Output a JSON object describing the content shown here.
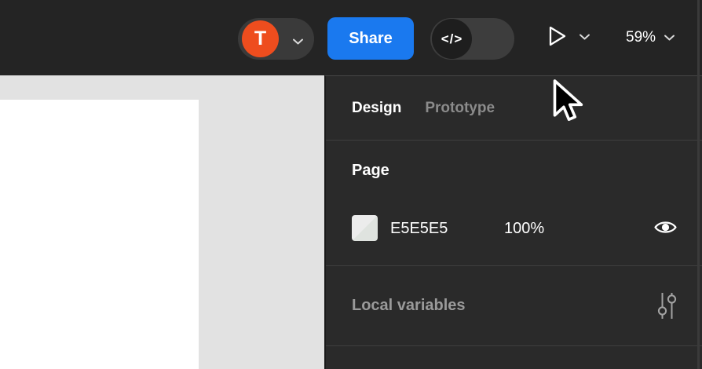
{
  "topbar": {
    "avatar": {
      "initial": "T",
      "color": "#EE4D1E"
    },
    "share": {
      "label": "Share",
      "color": "#1A79EF"
    },
    "dev_toggle": {
      "glyph": "</>",
      "state": "off"
    },
    "zoom": {
      "value": "59%"
    }
  },
  "panel": {
    "tabs": [
      {
        "label": "Design",
        "active": true
      },
      {
        "label": "Prototype",
        "active": false
      }
    ],
    "page": {
      "heading": "Page",
      "fill": {
        "hex": "E5E5E5",
        "opacity": "100%",
        "swatch_color": "#E5E5E5",
        "visible": true
      }
    },
    "local_variables": {
      "label": "Local variables"
    }
  },
  "canvas": {
    "background_hex": "#E5E5E5"
  }
}
